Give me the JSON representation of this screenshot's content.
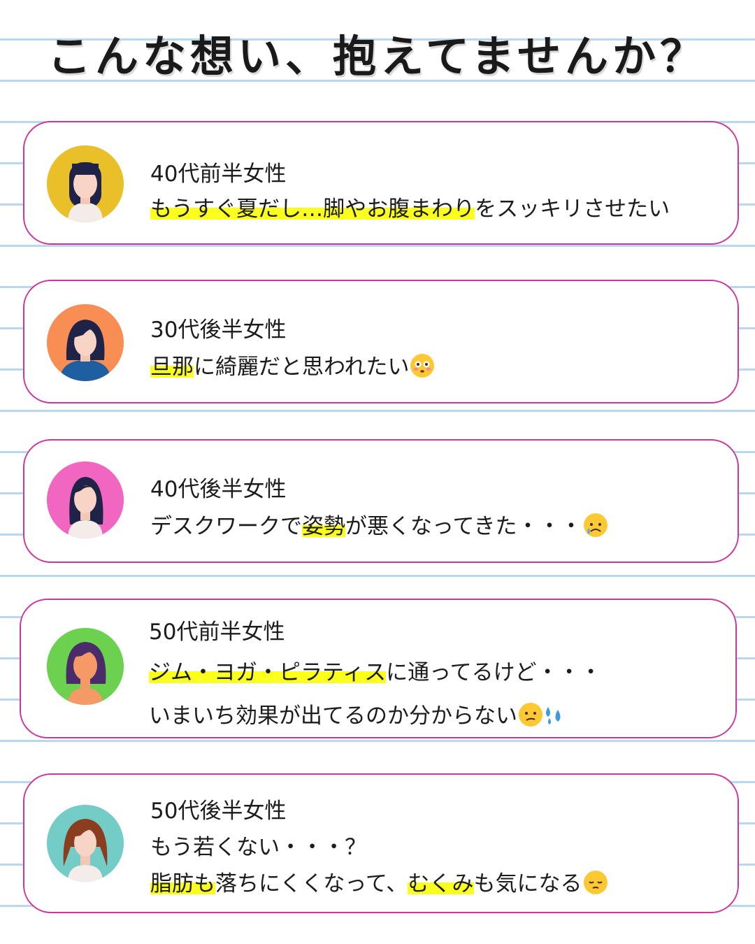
{
  "title": "こんな想い、抱えてませんか？",
  "cards": [
    {
      "label": "40代前半女性",
      "line1_hl": "もうすぐ夏だし…脚やお腹まわり",
      "line1_rest": "をスッキリさせたい"
    },
    {
      "label": "30代後半女性",
      "line1_hl": "旦那",
      "line1_rest": "に綺麗だと思われたい",
      "emoji": "flushed-face-emoji"
    },
    {
      "label": "40代後半女性",
      "line1_pre": "デスクワークで",
      "line1_hl": "姿勢",
      "line1_rest": "が悪くなってきた・・・",
      "emoji": "sad-sweat-face-emoji"
    },
    {
      "label": "50代前半女性",
      "line1_hl": "ジム・ヨガ・ピラティス",
      "line1_rest": "に通ってるけど・・・",
      "line2": "いまいち効果が出てるのか分からない",
      "emoji": "confused-face-emoji",
      "emoji2": "sweat-droplets-emoji"
    },
    {
      "label": "50代後半女性",
      "line1": "もう若くない・・・？",
      "line2_hl1": "脂肪も",
      "line2_mid": "落ちにくくなって、",
      "line2_hl2": "むくみ",
      "line2_rest": "も気になる",
      "emoji": "pensive-face-emoji"
    }
  ],
  "colors": {
    "card_border": "#c9379f",
    "highlight": "#fbff1e",
    "rule_line": "#b9d7ee",
    "avatar_bg": [
      "#e9bf2a",
      "#f98e55",
      "#f066c0",
      "#6bd14f",
      "#74ccc6"
    ]
  }
}
